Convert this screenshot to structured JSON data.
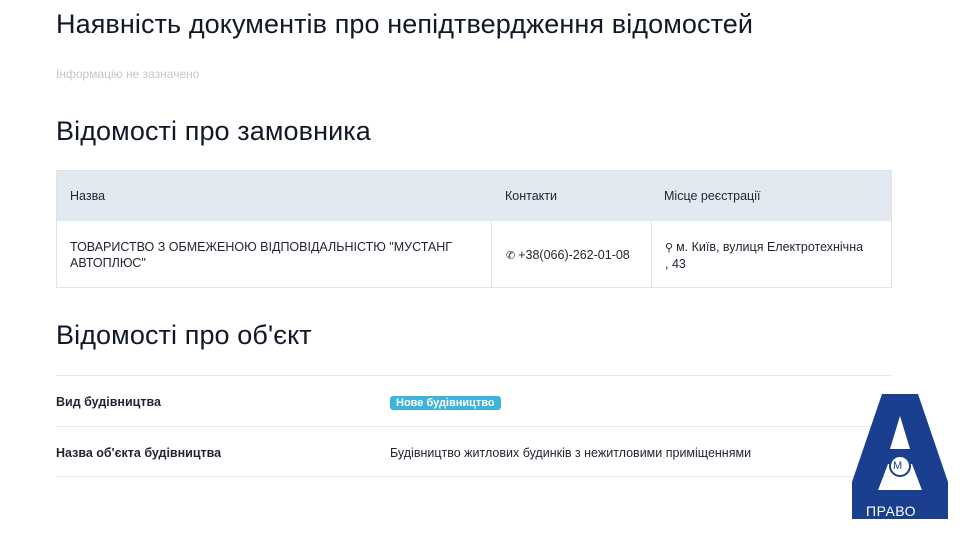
{
  "sections": {
    "non_confirmation_title": "Наявність документів про непідтвердження відомостей",
    "non_confirmation_note": "Інформацію не зазначено",
    "customer_title": "Відомості про замовника",
    "object_title": "Відомості про об'єкт"
  },
  "customer_table": {
    "headers": {
      "name": "Назва",
      "contacts": "Контакти",
      "registration": "Місце реєстрації"
    },
    "row": {
      "name": "ТОВАРИСТВО З ОБМЕЖЕНОЮ ВІДПОВІДАЛЬНІСТЮ \"МУСТАНГ АВТОПЛЮС\"",
      "phone": "+38(066)-262-01-08",
      "location": "м. Київ, вулиця Електротехнічна , 43"
    },
    "icons": {
      "phone": "phone-icon",
      "location": "map-marker-icon"
    }
  },
  "object_info": {
    "rows": [
      {
        "label": "Вид будівництва",
        "badge": "Нове будівництво"
      },
      {
        "label": "Назва об'єкта будівництва",
        "value": "Будівництво житлових будинків з нежитловими приміщеннями"
      }
    ]
  },
  "logo": {
    "text": "ПРАВО",
    "letter": "А",
    "mark": "М",
    "color": "#1a3f8f"
  },
  "colors": {
    "badge": "#3fb3d9",
    "table_header_bg": "#e2e9f0"
  }
}
